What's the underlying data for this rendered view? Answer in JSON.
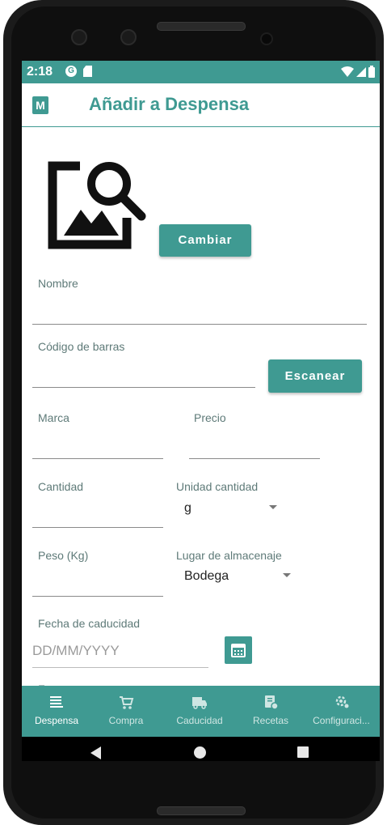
{
  "status_bar": {
    "time": "2:18",
    "g_icon": "G"
  },
  "app_bar": {
    "logo_letter": "M",
    "title": "Añadir a Despensa"
  },
  "form": {
    "change_image_button": "Cambiar",
    "name_label": "Nombre",
    "barcode_label": "Código de barras",
    "scan_button": "Escanear",
    "brand_label": "Marca",
    "price_label": "Precio",
    "quantity_label": "Cantidad",
    "unit_label": "Unidad cantidad",
    "unit_value": "g",
    "weight_label": "Peso (Kg)",
    "storage_label": "Lugar de almacenaje",
    "storage_value": "Bodega",
    "expiry_label": "Fecha de caducidad",
    "expiry_placeholder": "DD/MM/YYYY"
  },
  "bottom_nav": {
    "items": [
      {
        "label": "Despensa",
        "icon": "list-icon",
        "active": true
      },
      {
        "label": "Compra",
        "icon": "cart-icon",
        "active": false
      },
      {
        "label": "Caducidad",
        "icon": "truck-icon",
        "active": false
      },
      {
        "label": "Recetas",
        "icon": "recipe-icon",
        "active": false
      },
      {
        "label": "Configuraci...",
        "icon": "settings-icon",
        "active": false
      }
    ]
  },
  "colors": {
    "accent": "#3f9a92",
    "text": "#5e7a78"
  }
}
